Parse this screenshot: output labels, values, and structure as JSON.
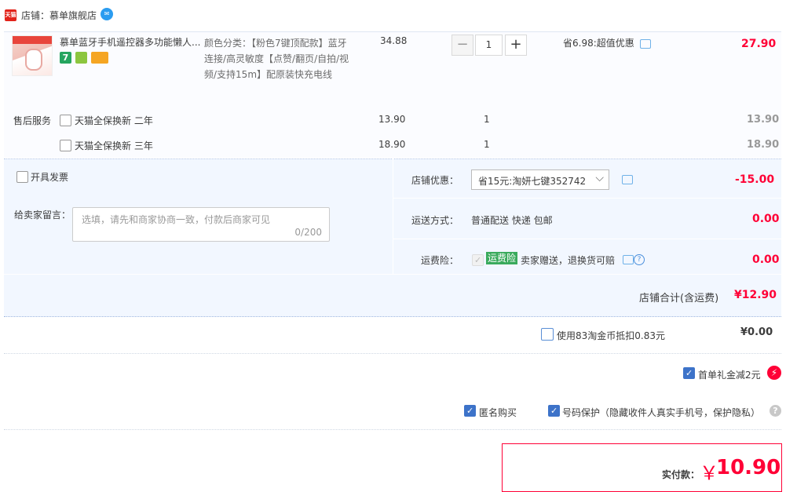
{
  "shop": {
    "label": "店铺：慕单旗舰店",
    "platform_icon": "tmall-icon",
    "chat_icon": "wangwang-chat-icon"
  },
  "item": {
    "title": "慕单蓝牙手机遥控器多功能懒人...",
    "sku_text": "颜色分类：【粉色7键顶配款】蓝牙连接/高灵敏度【点赞/翻页/自拍/视频/支持15m】配原装快充电线",
    "unit_price": "34.88",
    "quantity": "1",
    "qty_minus": "−",
    "qty_plus": "+",
    "promo": "省6.98:超值优惠",
    "subtotal": "27.90",
    "badge_7": "7",
    "badges": [
      "7-day-return-icon",
      "insurance-icon",
      "card-icon"
    ]
  },
  "after_sales": {
    "label": "售后服务",
    "options": [
      {
        "name": "天猫全保换新 二年",
        "price": "13.90",
        "qty": "1",
        "subtotal": "13.90"
      },
      {
        "name": "天猫全保换新 三年",
        "price": "18.90",
        "qty": "1",
        "subtotal": "18.90"
      }
    ]
  },
  "invoice": {
    "label": "开具发票"
  },
  "memo": {
    "label": "给卖家留言：",
    "placeholder": "选填，请先和商家协商一致，付款后商家可见",
    "count": "0/200"
  },
  "shop_discount": {
    "label": "店铺优惠：",
    "selected": "省15元:淘妍七键352742",
    "amount": "-15.00"
  },
  "shipping": {
    "label": "运送方式：",
    "method": "普通配送 快递 包邮",
    "amount": "0.00"
  },
  "insurance": {
    "label": "运费险：",
    "badge": "运费险",
    "desc": "卖家赠送，退换货可赔",
    "amount": "0.00"
  },
  "shop_total": {
    "label": "店铺合计(含运费)",
    "amount": "¥12.90"
  },
  "coins": {
    "label": "使用83淘金币抵扣0.83元",
    "amount": "¥0.00"
  },
  "first_gift": {
    "label": "首单礼金减2元",
    "bolt": "⚡"
  },
  "anonymous": {
    "label": "匿名购买"
  },
  "privacy": {
    "label": "号码保护（隐藏收件人真实手机号，保护隐私）",
    "help": "?"
  },
  "payment": {
    "label": "实付款：",
    "currency": "￥",
    "amount": "10.90"
  },
  "colors": {
    "accent_red": "#ff0036",
    "checkbox_blue": "#3d73c9",
    "panel_blue": "#f2f7ff"
  }
}
